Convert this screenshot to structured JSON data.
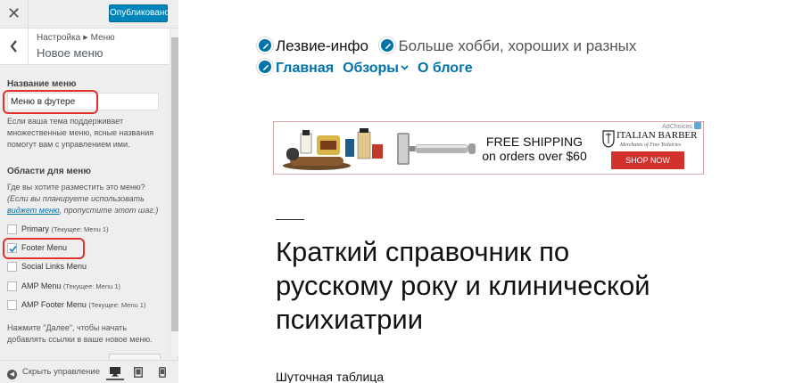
{
  "topbar": {
    "close_icon": "close-icon",
    "publish_label": "Опубликовано"
  },
  "section": {
    "breadcrumb_parent": "Настройка",
    "breadcrumb_current": "Меню",
    "title": "Новое меню"
  },
  "menu_name": {
    "label": "Название меню",
    "value": "Меню в футере",
    "help": "Если ваша тема поддерживает множественные меню, ясные названия помогут вам с управлением ими."
  },
  "locations": {
    "label": "Области для меню",
    "question": "Где вы хотите разместить это меню?",
    "hint_start": "(Если вы планируете использовать ",
    "hint_link": "виджет меню",
    "hint_end": ", пропустите этот шаг.)",
    "items": [
      {
        "label": "Primary",
        "note": "(Текущее: Menu 1)",
        "checked": false
      },
      {
        "label": "Footer Menu",
        "note": "",
        "checked": true
      },
      {
        "label": "Social Links Menu",
        "note": "",
        "checked": false
      },
      {
        "label": "AMP Menu",
        "note": "(Текущее: Menu 1)",
        "checked": false
      },
      {
        "label": "AMP Footer Menu",
        "note": "(Текущее: Menu 1)",
        "checked": false
      }
    ],
    "next_help": "Нажмите \"Далее\", чтобы начать добавлять ссылки в ваше новое меню."
  },
  "footer": {
    "collapse_label": "Скрыть управление",
    "devices": [
      "desktop-icon",
      "tablet-icon",
      "mobile-icon"
    ]
  },
  "preview": {
    "site_title": "Лезвие-инфо",
    "site_description": "Больше хобби, хороших и разных",
    "nav": [
      "Главная",
      "Обзоры",
      "О блоге"
    ],
    "ad": {
      "adchoices": "AdChoices",
      "line1": "FREE SHIPPING",
      "line2": "on orders over $60",
      "brand": "ITALIAN BARBER",
      "tagline": "Merchants of Fine Toiletries",
      "cta": "SHOP NOW"
    },
    "article_title": "Краткий справочник по русскому року и клинической психиатрии",
    "article_subtitle": "Шуточная таблица"
  },
  "colors": {
    "accent": "#0073aa",
    "publish": "#0085ba",
    "highlight": "#e0332e",
    "shop_button": "#d0312d"
  }
}
